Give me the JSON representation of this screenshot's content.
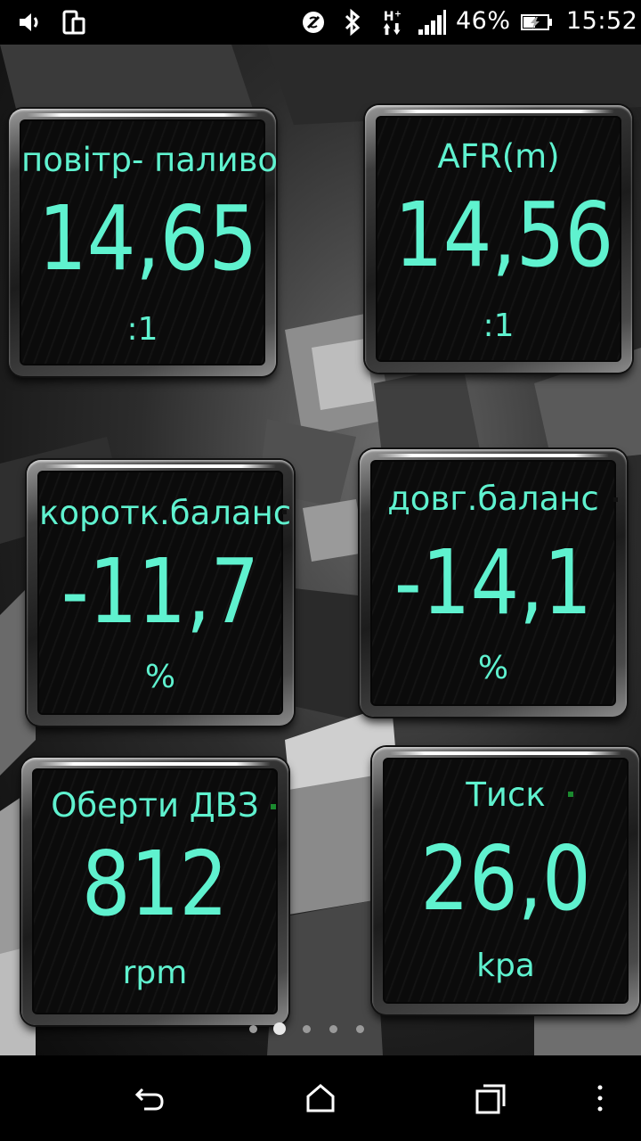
{
  "status_bar": {
    "battery_percent": "46%",
    "time": "15:52",
    "icons": [
      "volume-icon",
      "screen-rotate-icon",
      "nfc-icon",
      "bluetooth-icon",
      "hplus-data-icon",
      "signal-icon",
      "battery-charging-icon"
    ]
  },
  "gauges": [
    {
      "label": "повітр- паливо",
      "value": "14,65",
      "unit": ":1"
    },
    {
      "label": "AFR(m)",
      "value": "14,56",
      "unit": ":1"
    },
    {
      "label": "коротк.баланс",
      "value": "-11,7",
      "unit": "%"
    },
    {
      "label": "довг.баланс",
      "value": "-14,1",
      "unit": "%"
    },
    {
      "label": "Оберти ДВЗ",
      "value": "812",
      "unit": "rpm"
    },
    {
      "label": "Тиск",
      "value": "26,0",
      "unit": "kpa"
    }
  ],
  "pager": {
    "count": 5,
    "active_index": 1
  },
  "colors": {
    "gauge_text": "#5ff2cf",
    "status_dot": "#1b8a2f"
  },
  "nav_bar": {
    "icons": [
      "back-icon",
      "home-icon",
      "recents-icon",
      "overflow-menu-icon"
    ]
  }
}
